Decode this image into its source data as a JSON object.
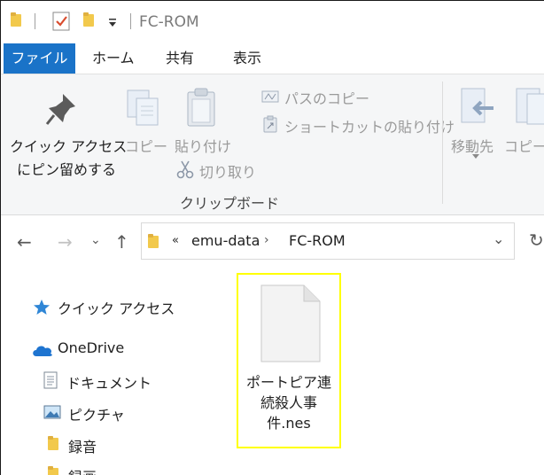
{
  "window": {
    "title": "FC-ROM"
  },
  "ribbon_tabs": [
    {
      "label": "ファイル"
    },
    {
      "label": "ホーム"
    },
    {
      "label": "共有"
    },
    {
      "label": "表示"
    }
  ],
  "ribbon": {
    "pin_line1": "クイック アクセス",
    "pin_line2": "にピン留めする",
    "copy": "コピー",
    "paste": "貼り付け",
    "copy_path": "パスのコピー",
    "paste_shortcut": "ショートカットの貼り付け",
    "cut": "切り取り",
    "group_clipboard": "クリップボード",
    "move_to": "移動先",
    "copy_to": "コピー先"
  },
  "address": {
    "overflow": "«",
    "crumbs": [
      "emu-data",
      "FC-ROM"
    ]
  },
  "sidebar": {
    "items": [
      {
        "label": "クイック アクセス",
        "icon": "star-icon"
      },
      {
        "label": "OneDrive",
        "icon": "cloud-icon"
      },
      {
        "label": "ドキュメント",
        "icon": "document-icon"
      },
      {
        "label": "ピクチャ",
        "icon": "picture-icon"
      },
      {
        "label": "録音",
        "icon": "folder-icon"
      },
      {
        "label": "録画",
        "icon": "folder-icon"
      }
    ]
  },
  "files": [
    {
      "name": "ポートピア連続殺人事件.nes",
      "line1": "ポートピア連",
      "line2": "続殺人事",
      "line3": "件.nes"
    }
  ],
  "colors": {
    "accent": "#1a73c8",
    "selection_outline": "#ffff00"
  }
}
